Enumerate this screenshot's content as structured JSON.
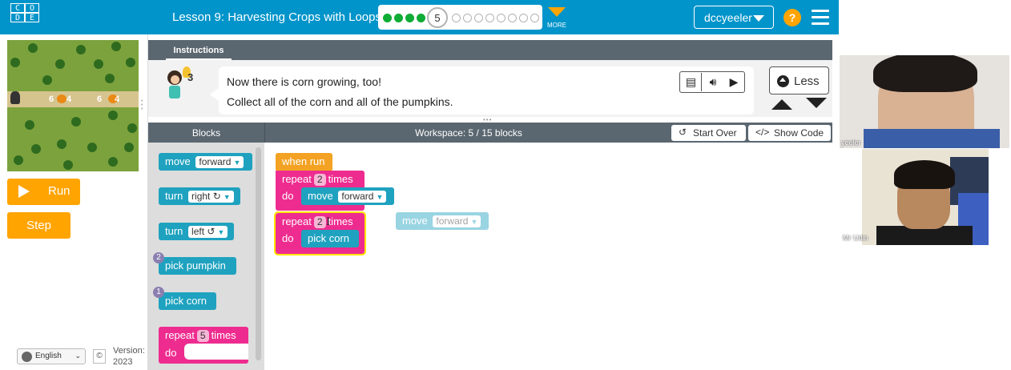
{
  "header": {
    "logo_letters": [
      "C",
      "O",
      "D",
      "E"
    ],
    "lesson_title": "Lesson 9: Harvesting Crops with Loops",
    "progress": {
      "completed": 4,
      "current": 5,
      "remaining": 8
    },
    "more_label": "MORE",
    "username": "dccyeeler",
    "help_label": "?"
  },
  "maze": {
    "labels": [
      "6",
      "4",
      "6",
      "4"
    ]
  },
  "controls": {
    "run_label": "Run",
    "step_label": "Step"
  },
  "footer": {
    "language": "English",
    "copyright": "©",
    "version_line1": "Version:",
    "version_line2": "2023"
  },
  "instructions": {
    "tab_label": "Instructions",
    "avatar_badge": "3",
    "line1": "Now there is corn growing, too!",
    "line2": "Collect all of the corn and all of the pumpkins.",
    "less_label": "Less"
  },
  "workspace_header": {
    "blocks_title": "Blocks",
    "workspace_title": "Workspace: 5 / 15 blocks",
    "start_over": "Start Over",
    "show_code": "Show Code"
  },
  "toolbox": {
    "move": {
      "verb": "move",
      "option": "forward"
    },
    "turn_right": {
      "verb": "turn",
      "option": "right ↻"
    },
    "turn_left": {
      "verb": "turn",
      "option": "left ↺"
    },
    "pick_pumpkin": {
      "label": "pick pumpkin",
      "badge": "2"
    },
    "pick_corn": {
      "label": "pick corn",
      "badge": "1"
    },
    "repeat": {
      "verb": "repeat",
      "count": "5",
      "suffix": "times",
      "do": "do"
    }
  },
  "program": {
    "when_run": "when run",
    "repeat1": {
      "verb": "repeat",
      "count": "2",
      "suffix": "times",
      "do": "do"
    },
    "move1": {
      "verb": "move",
      "option": "forward"
    },
    "repeat2": {
      "verb": "repeat",
      "count": "2",
      "suffix": "times",
      "do": "do"
    },
    "pick_corn": "pick corn",
    "floating_move": {
      "verb": "move",
      "option": "forward"
    }
  },
  "video": {
    "participant1": "yeeler",
    "participant2": "Mr Udin"
  },
  "colors": {
    "header": "#0094ca",
    "accent": "#ffa400",
    "teal_block": "#1fa2bf",
    "pink_block": "#ee2c8f",
    "orange_block": "#f3a223",
    "panel_header": "#5b6770"
  }
}
